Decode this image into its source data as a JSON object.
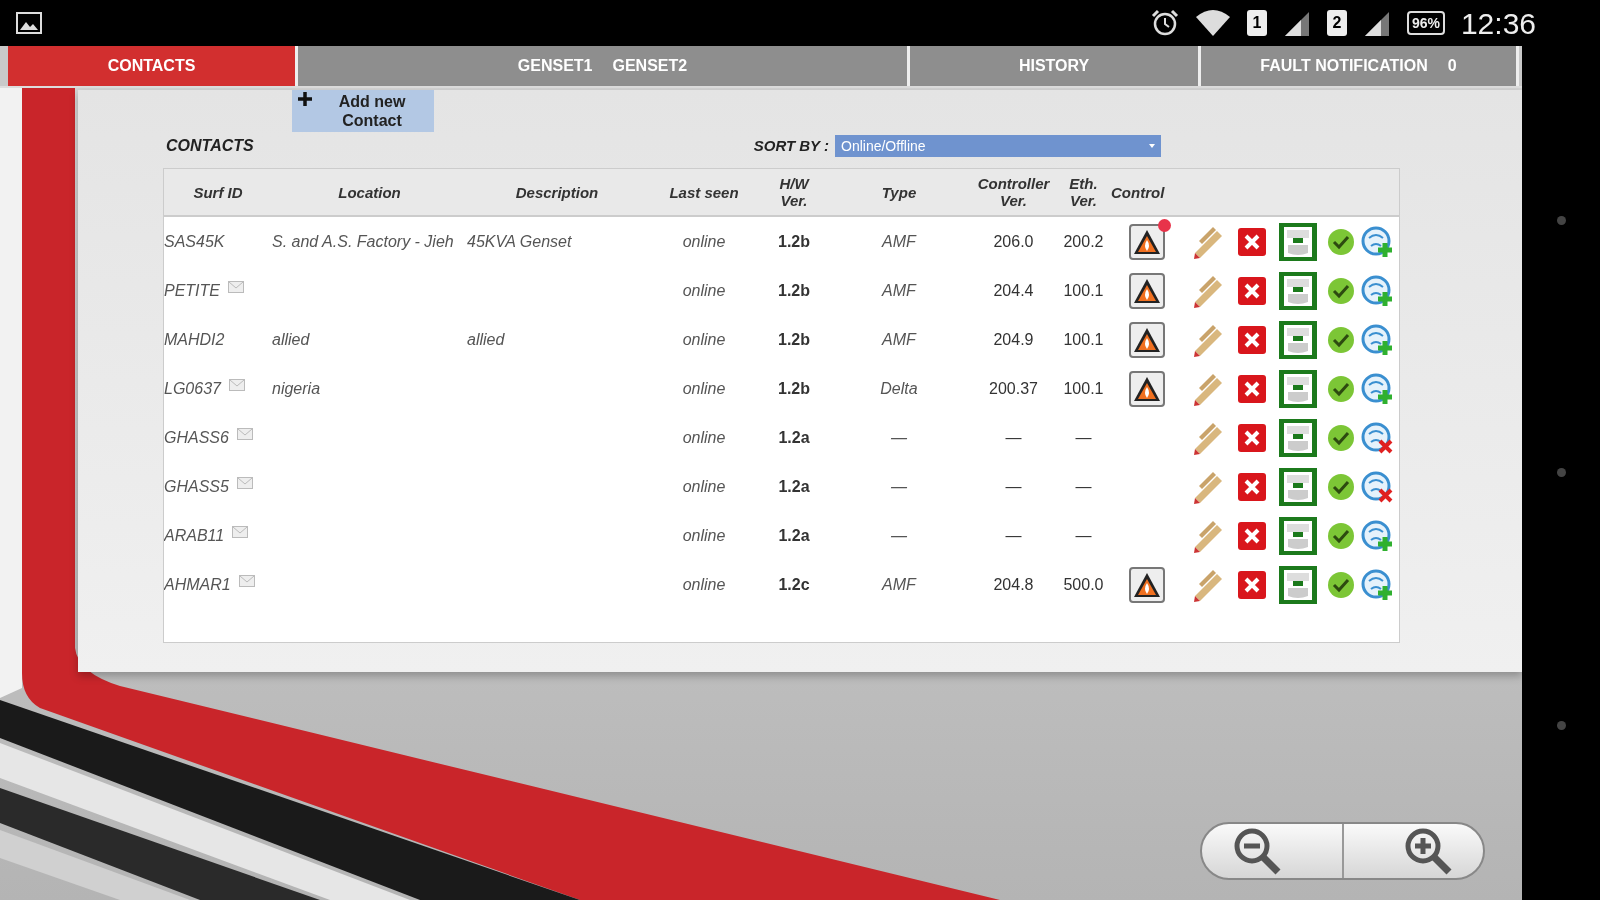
{
  "status_bar": {
    "sims": [
      "1",
      "2"
    ],
    "battery": "96%",
    "time": "12:36"
  },
  "tabs": [
    {
      "labels": [
        "CONTACTS"
      ],
      "selected": true
    },
    {
      "labels": [
        "GENSET1",
        "GENSET2"
      ],
      "selected": false
    },
    {
      "labels": [
        "HISTORY"
      ],
      "selected": false
    },
    {
      "labels": [
        "FAULT NOTIFICATION",
        "0"
      ],
      "selected": false
    }
  ],
  "add_button": {
    "label": "Add new Contact"
  },
  "contacts": {
    "title": "CONTACTS",
    "sort_label": "SORT BY :",
    "sort_value": "Online/Offline",
    "columns": [
      "Surf ID",
      "Location",
      "Description",
      "Last seen",
      "H/W Ver.",
      "Type",
      "Controller Ver.",
      "Eth. Ver.",
      "Control"
    ],
    "rows": [
      {
        "surf_id": "SAS45K",
        "mail": false,
        "location": "S. and A.S. Factory - Jieh",
        "description": "45KVA Genset",
        "last_seen": "online",
        "hw_ver": "1.2b",
        "type": "AMF",
        "controller_ver": "206.0",
        "eth_ver": "200.2",
        "alarm": true,
        "alert": true,
        "link_error": false
      },
      {
        "surf_id": "PETITE",
        "mail": true,
        "last_seen": "online",
        "hw_ver": "1.2b",
        "type": "AMF",
        "controller_ver": "204.4",
        "eth_ver": "100.1",
        "alarm": true,
        "alert": false,
        "link_error": false
      },
      {
        "surf_id": "MAHDI2",
        "mail": false,
        "location": "allied",
        "description": "allied",
        "last_seen": "online",
        "hw_ver": "1.2b",
        "type": "AMF",
        "controller_ver": "204.9",
        "eth_ver": "100.1",
        "alarm": true,
        "alert": false,
        "link_error": false
      },
      {
        "surf_id": "LG0637",
        "mail": true,
        "location": "nigeria",
        "last_seen": "online",
        "hw_ver": "1.2b",
        "type": "Delta",
        "controller_ver": "200.37",
        "eth_ver": "100.1",
        "alarm": true,
        "alert": false,
        "link_error": false
      },
      {
        "surf_id": "GHASS6",
        "mail": true,
        "last_seen": "online",
        "hw_ver": "1.2a",
        "type": "—",
        "controller_ver": "—",
        "eth_ver": "—",
        "alarm": false,
        "alert": false,
        "link_error": true
      },
      {
        "surf_id": "GHASS5",
        "mail": true,
        "last_seen": "online",
        "hw_ver": "1.2a",
        "type": "—",
        "controller_ver": "—",
        "eth_ver": "—",
        "alarm": false,
        "alert": false,
        "link_error": true
      },
      {
        "surf_id": "ARAB11",
        "mail": true,
        "last_seen": "online",
        "hw_ver": "1.2a",
        "type": "—",
        "controller_ver": "—",
        "eth_ver": "—",
        "alarm": false,
        "alert": false,
        "link_error": false
      },
      {
        "surf_id": "AHMAR1",
        "mail": true,
        "last_seen": "online",
        "hw_ver": "1.2c",
        "type": "AMF",
        "controller_ver": "204.8",
        "eth_ver": "500.0",
        "alarm": true,
        "alert": false,
        "link_error": false
      }
    ]
  }
}
